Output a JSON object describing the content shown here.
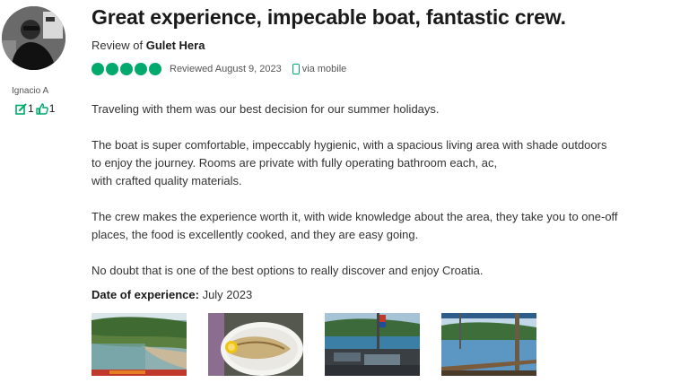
{
  "reviewer": {
    "name": "Ignacio A",
    "contributions": "1",
    "helpful_votes": "1"
  },
  "review": {
    "title": "Great experience, impecable boat, fantastic crew.",
    "review_of_prefix": "Review of",
    "review_of_place": "Gulet Hera",
    "rating": 5,
    "reviewed_date": "Reviewed August 9, 2023",
    "source": "via mobile",
    "paragraphs": [
      [
        "Traveling with them was our best decision for our summer holidays."
      ],
      [
        "The boat is super comfortable, impeccably hygienic, with a spacious living area with shade outdoors",
        "to enjoy the journey. Rooms are private with fully operating bathroom each, ac,",
        "with crafted quality materials."
      ],
      [
        "The crew makes the experience worth it, with wide knowledge about the area, they take you to one-off",
        "places, the food is excellently cooked, and they are easy going."
      ],
      [
        "No doubt that is one of the best options to really discover and enjoy Croatia."
      ]
    ],
    "date_of_experience_label": "Date of experience:",
    "date_of_experience": "July 2023"
  },
  "colors": {
    "rating_green": "#00aa6c",
    "title_text": "#1a1a1a",
    "body_text": "#333333"
  },
  "icons": {
    "contributions": "pencil-square-icon",
    "helpful": "thumbs-up-icon",
    "mobile": "phone-icon"
  }
}
